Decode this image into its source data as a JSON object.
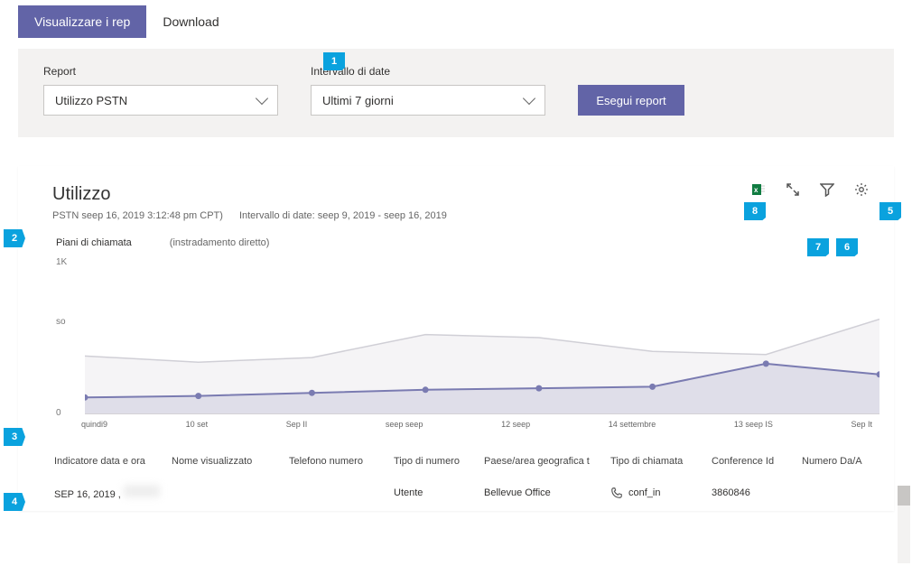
{
  "tabs": {
    "view": "Visualizzare i rep",
    "download": "Download"
  },
  "filters": {
    "report_label": "Report",
    "report_value": "Utilizzo PSTN",
    "range_label": "Intervallo di date",
    "range_value": "Ultimi 7 giorni",
    "run_label": "Esegui report"
  },
  "card": {
    "title": "Utilizzo",
    "subtitle1": "PSTN seep 16, 2019 3:12:48 pm CPT)",
    "subtitle2": "Intervallo di date: seep 9, 2019 - seep 16, 2019",
    "series_tabs": [
      "Piani di chiamata",
      "(instradamento diretto)"
    ]
  },
  "chart_data": {
    "type": "line",
    "categories": [
      "quindi9",
      "10 set",
      "Sep II",
      "seep seep",
      "12 seep",
      "14 settembre",
      "13 seep IS",
      "Sep It"
    ],
    "series": [
      {
        "name": "Piani di chiamata",
        "values": [
          110,
          120,
          140,
          160,
          170,
          180,
          330,
          260
        ],
        "color": "#6264a7",
        "dots": true
      },
      {
        "name": "instradamento diretto",
        "values": [
          380,
          340,
          370,
          520,
          500,
          410,
          390,
          620
        ],
        "color": "#d0cfd6",
        "dots": false
      }
    ],
    "ylabels": [
      "0",
      "so",
      "1K"
    ],
    "ylim": [
      0,
      1000
    ]
  },
  "table": {
    "headers": [
      "Indicatore data e ora",
      "Nome visualizzato",
      "Telefono numero",
      "Tipo di numero",
      "Paese/area geografica t",
      "Tipo di chiamata",
      "Conference Id",
      "Numero Da/A"
    ],
    "row": {
      "date": "SEP 16, 2019 ,",
      "tipo_numero": "Utente",
      "paese": "Bellevue Office",
      "tipo_chiamata": "conf_in",
      "conf_id": "3860846"
    }
  },
  "callouts": {
    "c1": "1",
    "c2": "2",
    "c3": "3",
    "c4": "4",
    "c5": "5",
    "c6": "6",
    "c7": "7",
    "c8": "8"
  }
}
